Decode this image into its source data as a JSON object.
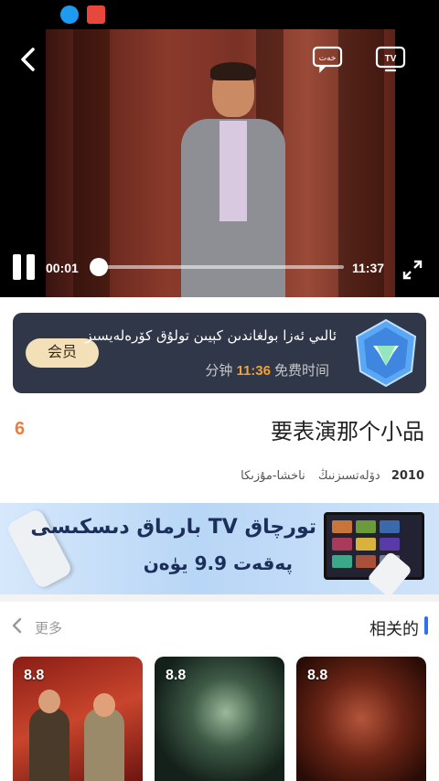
{
  "player": {
    "current_time": "00:01",
    "total_time": "11:37",
    "progress": 0.0014,
    "subtitle_icon_text": "خەت",
    "tv_icon_text": "TV"
  },
  "vip_banner": {
    "button_label": "会员",
    "message": "ئالىي ئەزا بولغاندىن كېيىن تولۇق كۆرەلەيسىز",
    "time_prefix": "分钟",
    "time_value": "11:36",
    "time_suffix": "免费时间"
  },
  "video": {
    "rating": "6",
    "title": "要表演那个小品",
    "year": "2010",
    "tags": [
      "دۆلەتسىزنىڭ",
      "ناخشا-مۇزىكا"
    ]
  },
  "ad": {
    "line1": "تورچاق TV بارماق دىسكىسى",
    "line2": "پەقەت 9.9 يۈەن"
  },
  "related": {
    "title": "相关的",
    "more_label": "更多",
    "items": [
      {
        "score": "8.8"
      },
      {
        "score": "8.8"
      },
      {
        "score": "8.8"
      }
    ]
  },
  "colors": {
    "accent_orange": "#f07c3a",
    "vip_bg": "#2f3748",
    "vip_gold": "#f3dfb8",
    "related_bar": "#2f6ff0"
  }
}
